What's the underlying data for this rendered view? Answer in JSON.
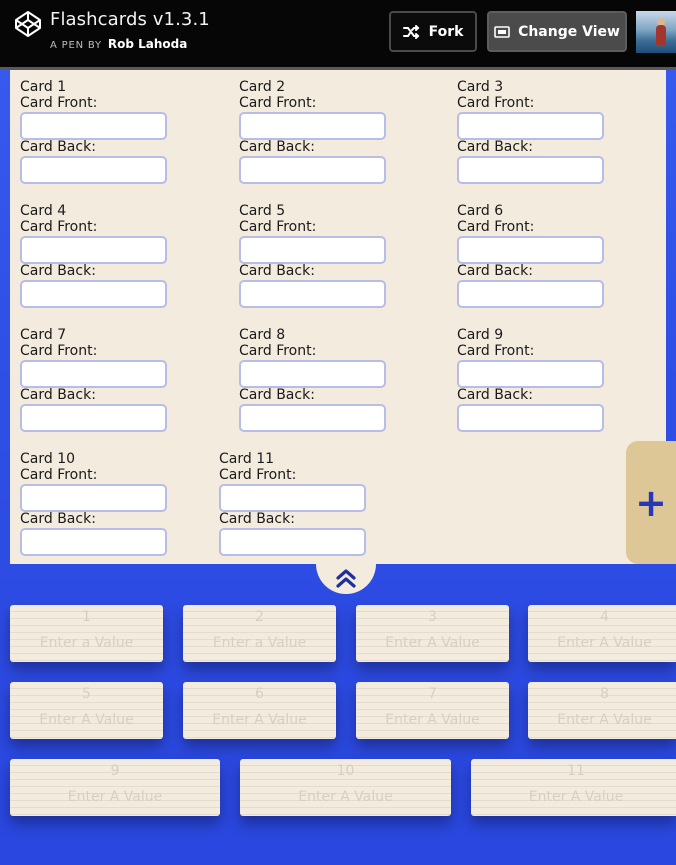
{
  "header": {
    "title": "Flashcards v1.3.1",
    "byline_prefix": "A PEN BY",
    "author": "Rob Lahoda",
    "fork_label": "Fork",
    "change_view_label": "Change View"
  },
  "editor": {
    "front_label": "Card Front:",
    "back_label": "Card Back:",
    "cards": [
      {
        "title": "Card 1"
      },
      {
        "title": "Card 2"
      },
      {
        "title": "Card 3"
      },
      {
        "title": "Card 4"
      },
      {
        "title": "Card 5"
      },
      {
        "title": "Card 6"
      },
      {
        "title": "Card 7"
      },
      {
        "title": "Card 8"
      },
      {
        "title": "Card 9"
      },
      {
        "title": "Card 10"
      },
      {
        "title": "Card 11"
      }
    ],
    "add_label": "+"
  },
  "flashcards": [
    {
      "number": "1",
      "value": "Enter a Value"
    },
    {
      "number": "2",
      "value": "Enter a Value"
    },
    {
      "number": "3",
      "value": "Enter A Value"
    },
    {
      "number": "4",
      "value": "Enter A Value"
    },
    {
      "number": "5",
      "value": "Enter A Value"
    },
    {
      "number": "6",
      "value": "Enter A Value"
    },
    {
      "number": "7",
      "value": "Enter A Value"
    },
    {
      "number": "8",
      "value": "Enter A Value"
    },
    {
      "number": "9",
      "value": "Enter A Value"
    },
    {
      "number": "10",
      "value": "Enter A Value"
    },
    {
      "number": "11",
      "value": "Enter A Value"
    }
  ],
  "colors": {
    "background": "#2f4fe6",
    "panel": "#f3ebde",
    "accent": "#2637b8",
    "add_tab": "#ddc796",
    "field_border": "#b6bde9"
  },
  "icons": {
    "logo": "codepen-logo-icon",
    "fork": "fork-icon",
    "change_view": "layout-icon",
    "toggle": "double-chevron-up-icon",
    "add": "plus-icon"
  }
}
